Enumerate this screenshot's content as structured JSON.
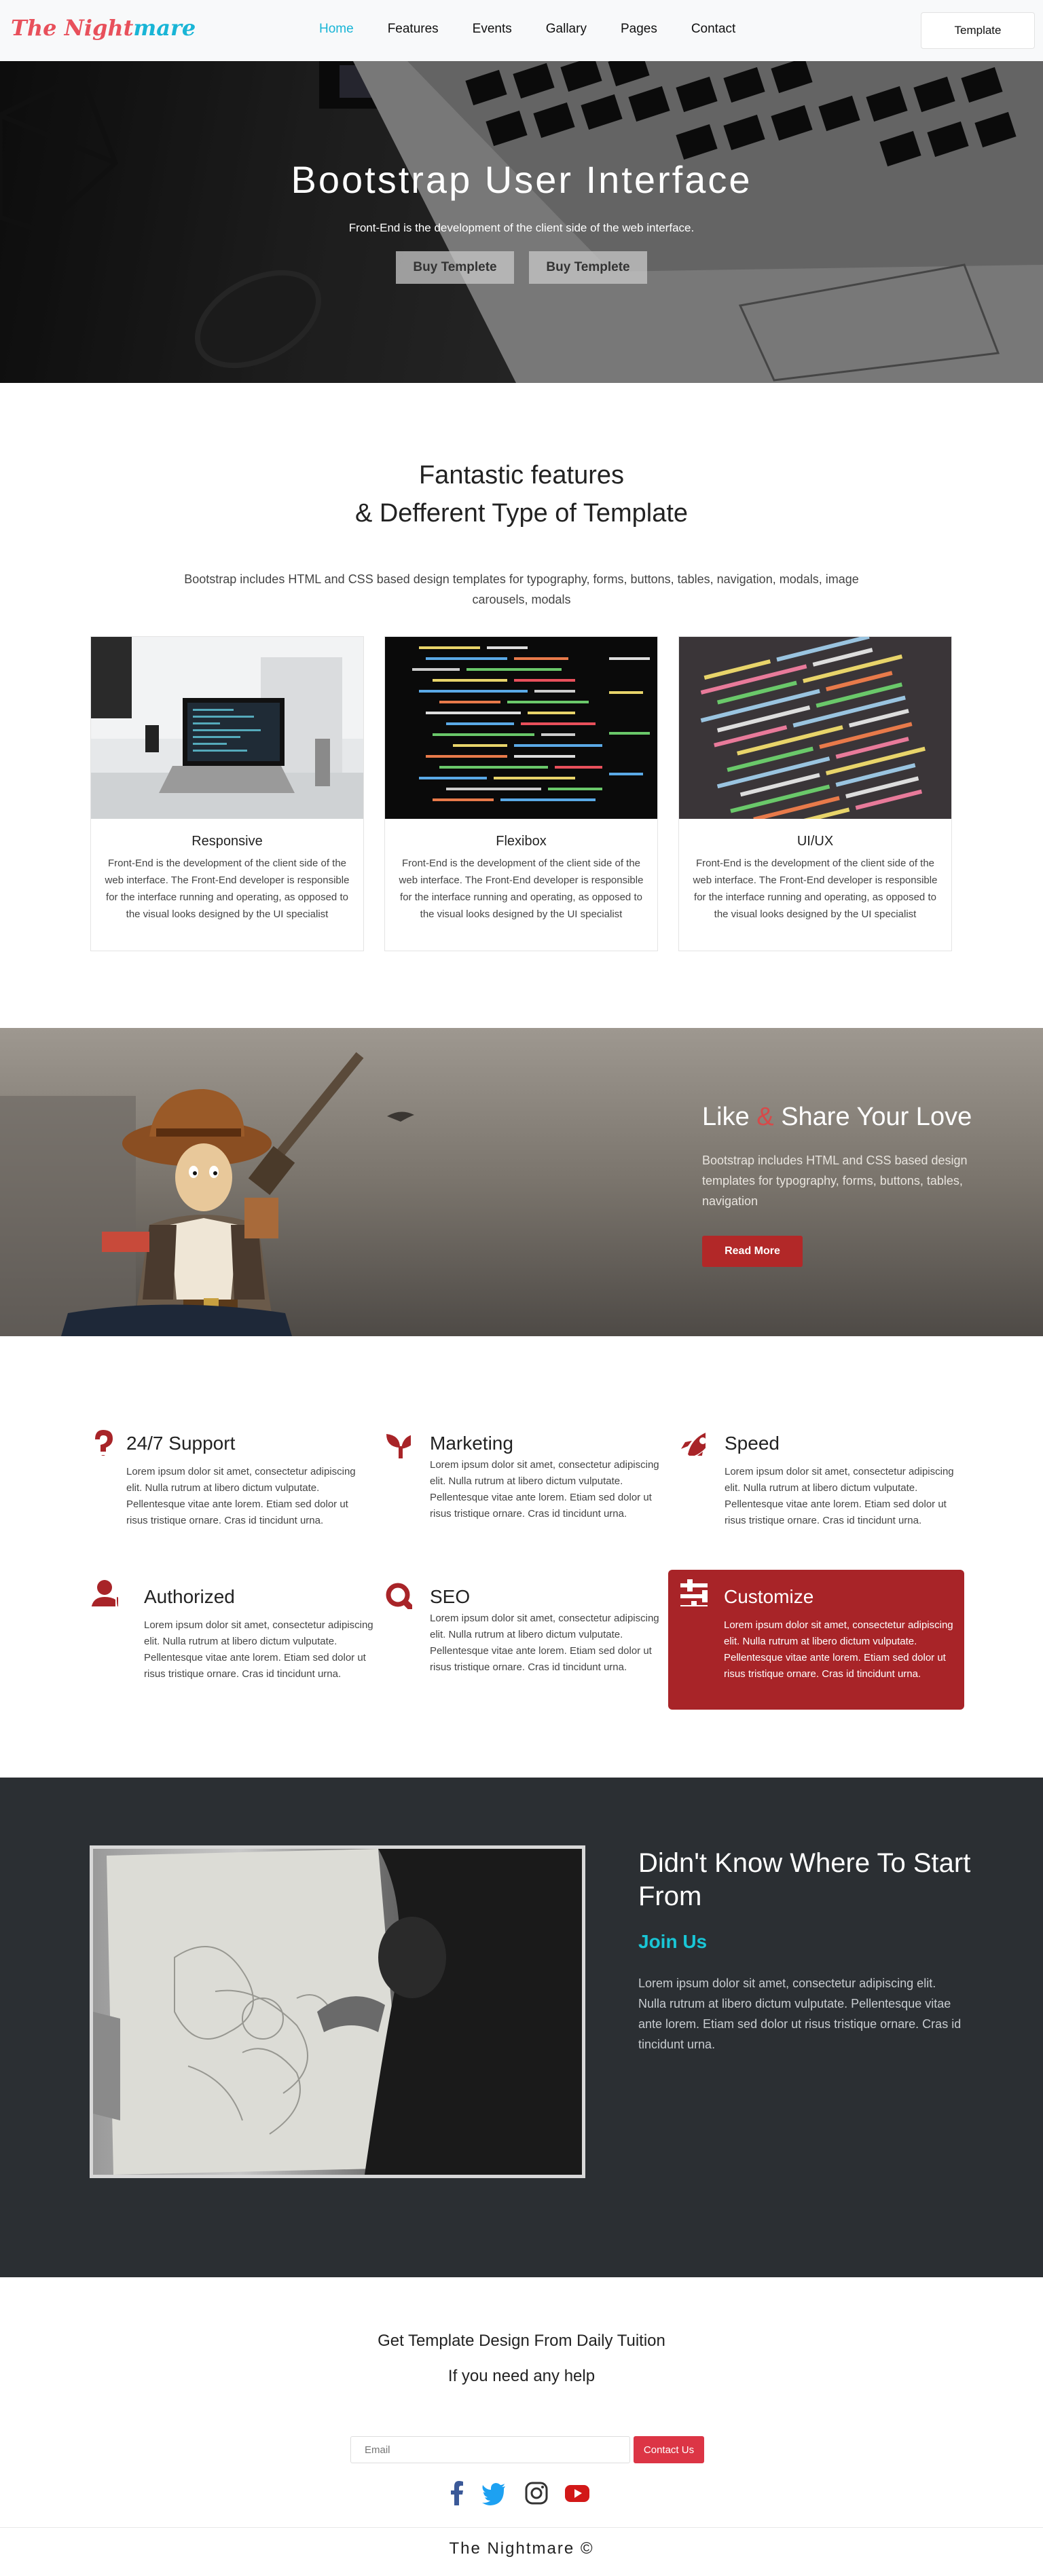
{
  "nav": {
    "logo_part1": "The Night",
    "logo_part2": "mare",
    "links": [
      "Home",
      "Features",
      "Events",
      "Gallary",
      "Pages",
      "Contact"
    ],
    "template_button": "Template"
  },
  "hero": {
    "title": "Bootstrap User Interface",
    "subtitle": "Front-End is the development of the client side of the web interface.",
    "buttons": [
      "Buy Templete",
      "Buy Templete"
    ]
  },
  "features": {
    "title_line1": "Fantastic features",
    "title_line2": "& Defferent Type of Template",
    "description": "Bootstrap includes HTML and CSS based design templates for typography, forms, buttons, tables, navigation, modals, image carousels, modals",
    "cards": [
      {
        "title": "Responsive",
        "text": "Front-End is the development of the client side of the web interface. The Front-End developer is responsible for the interface running and operating, as opposed to the visual looks designed by the UI specialist"
      },
      {
        "title": "Flexibox",
        "text": "Front-End is the development of the client side of the web interface. The Front-End developer is responsible for the interface running and operating, as opposed to the visual looks designed by the UI specialist"
      },
      {
        "title": "UI/UX",
        "text": "Front-End is the development of the client side of the web interface. The Front-End developer is responsible for the interface running and operating, as opposed to the visual looks designed by the UI specialist"
      }
    ]
  },
  "banner": {
    "title_part1": "Like ",
    "title_amp": "&",
    "title_part2": " Share Your Love",
    "text": "Bootstrap includes HTML and CSS based design templates for typography, forms, buttons, tables, navigation",
    "button": "Read More"
  },
  "services": [
    {
      "title": "24/7 Support",
      "icon": "question-icon",
      "text": "Lorem ipsum dolor sit amet, consectetur adipiscing elit. Nulla rutrum at libero dictum vulputate. Pellentesque vitae ante lorem. Etiam sed dolor ut risus tristique ornare. Cras id tincidunt urna."
    },
    {
      "title": "Marketing",
      "icon": "seedling-icon",
      "text": "Lorem ipsum dolor sit amet, consectetur adipiscing elit. Nulla rutrum at libero dictum vulputate. Pellentesque vitae ante lorem. Etiam sed dolor ut risus tristique ornare. Cras id tincidunt urna."
    },
    {
      "title": "Speed",
      "icon": "rocket-icon",
      "text": "Lorem ipsum dolor sit amet, consectetur adipiscing elit. Nulla rutrum at libero dictum vulputate. Pellentesque vitae ante lorem. Etiam sed dolor ut risus tristique ornare. Cras id tincidunt urna."
    },
    {
      "title": "Authorized",
      "icon": "user-shield-icon",
      "text": "Lorem ipsum dolor sit amet, consectetur adipiscing elit. Nulla rutrum at libero dictum vulputate. Pellentesque vitae ante lorem. Etiam sed dolor ut risus tristique ornare. Cras id tincidunt urna."
    },
    {
      "title": "SEO",
      "icon": "search-icon",
      "text": "Lorem ipsum dolor sit amet, consectetur adipiscing elit. Nulla rutrum at libero dictum vulputate. Pellentesque vitae ante lorem. Etiam sed dolor ut risus tristique ornare. Cras id tincidunt urna."
    },
    {
      "title": "Customize",
      "icon": "sliders-icon",
      "text": "Lorem ipsum dolor sit amet, consectetur adipiscing elit. Nulla rutrum at libero dictum vulputate. Pellentesque vitae ante lorem. Etiam sed dolor ut risus tristique ornare. Cras id tincidunt urna."
    }
  ],
  "join": {
    "title": "Didn't Know Where To Start From",
    "link": "Join Us",
    "text": "Lorem ipsum dolor sit amet, consectetur adipiscing elit. Nulla rutrum at libero dictum vulputate. Pellentesque vitae ante lorem. Etiam sed dolor ut risus tristique ornare. Cras id tincidunt urna."
  },
  "contact": {
    "title": "Get Template Design From Daily Tuition",
    "subtitle": "If you need any help",
    "email_placeholder": "Email",
    "button": "Contact Us",
    "social": [
      "facebook-icon",
      "twitter-icon",
      "instagram-icon",
      "youtube-icon"
    ]
  },
  "footer": "The Nightmare ©",
  "colors": {
    "accent_red": "#a82428",
    "accent_cyan": "#19b5d6",
    "logo_pink": "#e8505b",
    "dark_bg": "#2b2f33"
  }
}
